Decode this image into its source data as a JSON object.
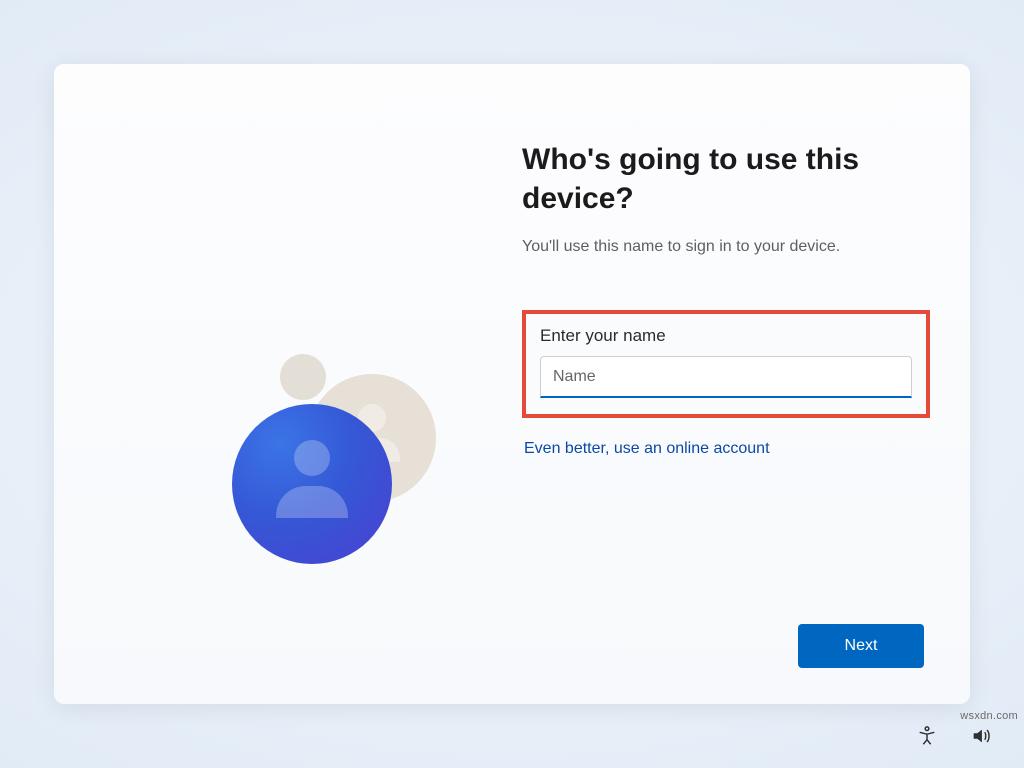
{
  "heading": "Who's going to use this device?",
  "subtext": "You'll use this name to sign in to your device.",
  "form": {
    "label": "Enter your name",
    "placeholder": "Name",
    "value": ""
  },
  "online_link": "Even better, use an online account",
  "next_label": "Next",
  "watermark": "wsxdn.com",
  "colors": {
    "accent": "#0067c0",
    "highlight_border": "#e44a3a",
    "link": "#0a4aa6"
  }
}
